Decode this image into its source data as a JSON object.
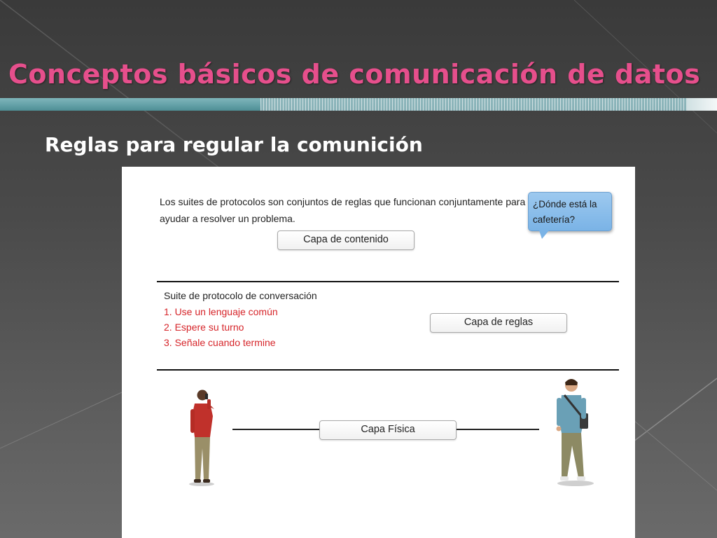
{
  "slide": {
    "title": "Conceptos básicos de comunicación de datos",
    "subtitle": "Reglas para regular la comunición"
  },
  "figure": {
    "intro_text": "Los suites de protocolos son conjuntos de reglas que funcionan conjuntamente para ayudar a resolver un problema.",
    "speech_bubble": "¿Dónde está la cafetería?",
    "content_layer_label": "Capa de contenido",
    "suite_title": "Suite de protocolo de conversación",
    "rules": [
      "1. Use un lenguaje común",
      "2. Espere su turno",
      "3. Señale cuando termine"
    ],
    "rules_layer_label": "Capa de reglas",
    "physical_layer_label": "Capa Física"
  },
  "colors": {
    "title": "#e64f8c",
    "rules_text": "#d6252a",
    "bubble": "#8fc0ec",
    "band": "#5f9ea5"
  }
}
